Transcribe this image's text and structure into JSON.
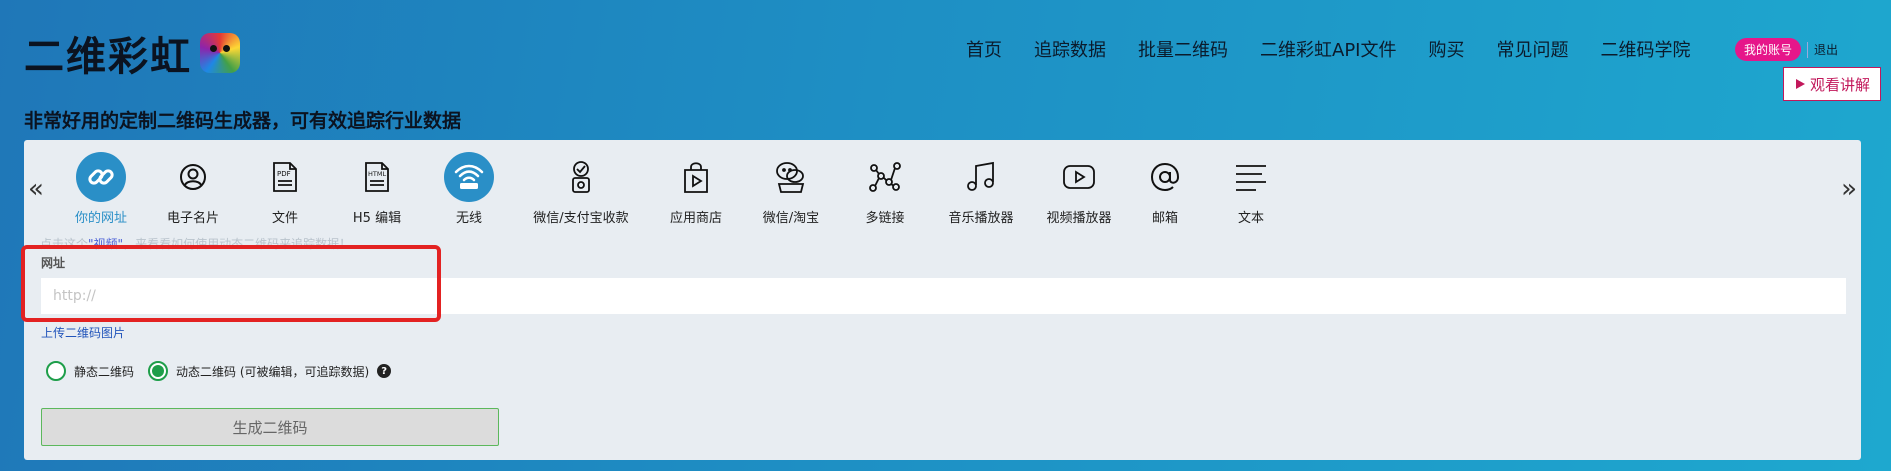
{
  "brand": {
    "name": "二维彩虹",
    "logo_icon": "rainbow-bear-icon"
  },
  "nav": [
    {
      "label": "首页"
    },
    {
      "label": "追踪数据"
    },
    {
      "label": "批量二维码"
    },
    {
      "label": "二维彩虹API文件"
    },
    {
      "label": "购买"
    },
    {
      "label": "常见问题"
    },
    {
      "label": "二维码学院"
    }
  ],
  "account": {
    "my_account": "我的账号",
    "logout": "退出"
  },
  "watch": {
    "label": "观看讲解",
    "icon": "play-icon"
  },
  "tagline": "非常好用的定制二维码生成器，可有效追踪行业数据",
  "types": [
    {
      "label": "你的网址",
      "icon": "link-icon",
      "active": true
    },
    {
      "label": "电子名片",
      "icon": "user-icon"
    },
    {
      "label": "文件",
      "icon": "pdf-icon"
    },
    {
      "label": "H5 编辑",
      "icon": "html-icon"
    },
    {
      "label": "无线",
      "icon": "wifi-icon"
    },
    {
      "label": "微信/支付宝收款",
      "icon": "payment-icon"
    },
    {
      "label": "应用商店",
      "icon": "app-store-icon"
    },
    {
      "label": "微信/淘宝",
      "icon": "wechat-icon"
    },
    {
      "label": "多链接",
      "icon": "multi-link-icon"
    },
    {
      "label": "音乐播放器",
      "icon": "music-icon"
    },
    {
      "label": "视频播放器",
      "icon": "video-icon"
    },
    {
      "label": "邮箱",
      "icon": "email-icon"
    },
    {
      "label": "文本",
      "icon": "text-icon"
    }
  ],
  "hint": {
    "prefix": "点击这个",
    "link": "\"视频\"",
    "suffix": "，来看看如何使用动态二维码来追踪数据！"
  },
  "form": {
    "url_label": "网址",
    "url_placeholder": "http://",
    "upload_link": "上传二维码图片",
    "static_label": "静态二维码",
    "dynamic_label": "动态二维码 (可被编辑，可追踪数据)",
    "generate_label": "生成二维码"
  },
  "colors": {
    "accent": "#2a8fc7",
    "badge": "#e6168a",
    "highlight": "#e32222",
    "radio": "#1e9e4a"
  }
}
